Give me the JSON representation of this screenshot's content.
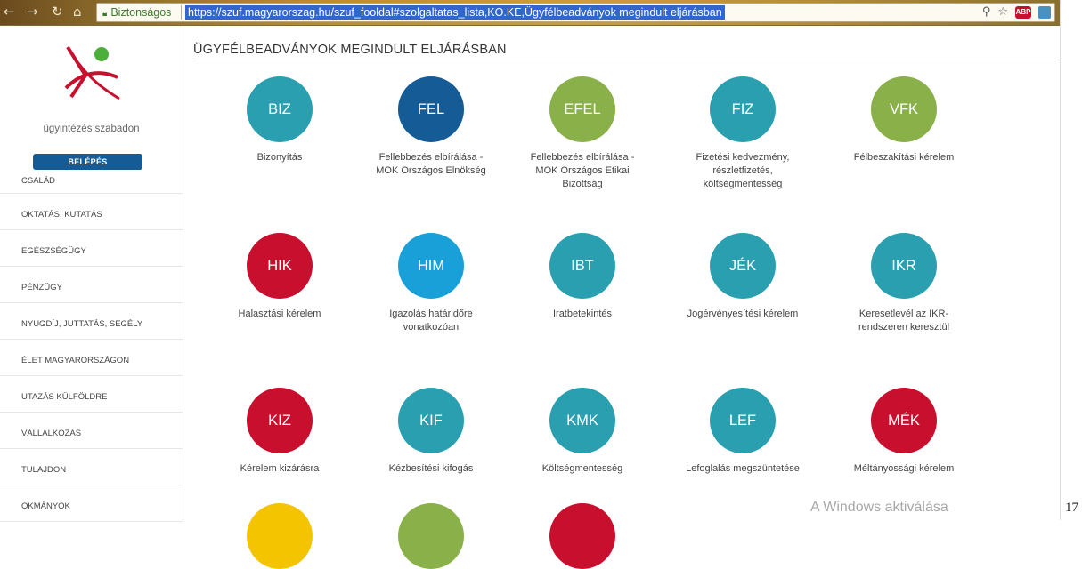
{
  "browser": {
    "secure_label": "Biztonságos",
    "url": "https://szuf.magyarorszag.hu/szuf_fooldal#szolgaltatas_lista,KO.KE,Ügyfélbeadványok megindult eljárásban",
    "abp_label": "ABP"
  },
  "sidebar": {
    "logo_text": "ügyintézés szabadon",
    "login_label": "BELÉPÉS",
    "items": [
      {
        "label": "CSALÁD"
      },
      {
        "label": "OKTATÁS, KUTATÁS"
      },
      {
        "label": "EGÉSZSÉGÜGY"
      },
      {
        "label": "PÉNZÜGY"
      },
      {
        "label": "NYUGDÍJ, JUTTATÁS, SEGÉLY"
      },
      {
        "label": "ÉLET MAGYARORSZÁGON"
      },
      {
        "label": "UTAZÁS KÜLFÖLDRE"
      },
      {
        "label": "VÁLLALKOZÁS"
      },
      {
        "label": "TULAJDON"
      },
      {
        "label": "OKMÁNYOK"
      }
    ]
  },
  "main": {
    "title": "ÜGYFÉLBEADVÁNYOK MEGINDULT ELJÁRÁSBAN",
    "tiles": [
      {
        "code": "BIZ",
        "label": "Bizonyítás",
        "color": "#2a9fb0"
      },
      {
        "code": "FEL",
        "label": "Fellebbezés elbírálása - MOK Országos Elnökség",
        "color": "#155b95"
      },
      {
        "code": "EFEL",
        "label": "Fellebbezés elbírálása - MOK Országos Etikai Bizottság",
        "color": "#8ab04a"
      },
      {
        "code": "FIZ",
        "label": "Fizetési kedvezmény, részletfizetés, költségmentesség",
        "color": "#2a9fb0"
      },
      {
        "code": "VFK",
        "label": "Félbeszakítási kérelem",
        "color": "#8ab04a"
      },
      {
        "code": "HIK",
        "label": "Halasztási kérelem",
        "color": "#c8102e"
      },
      {
        "code": "HIM",
        "label": "Igazolás határidőre vonatkozóan",
        "color": "#1aa0d8"
      },
      {
        "code": "IBT",
        "label": "Iratbetekintés",
        "color": "#2a9fb0"
      },
      {
        "code": "JÉK",
        "label": "Jogérvényesítési kérelem",
        "color": "#2a9fb0"
      },
      {
        "code": "IKR",
        "label": "Keresetlevél az IKR-rendszeren keresztül",
        "color": "#2a9fb0"
      },
      {
        "code": "KIZ",
        "label": "Kérelem kizárásra",
        "color": "#c8102e"
      },
      {
        "code": "KIF",
        "label": "Kézbesítési kifogás",
        "color": "#2a9fb0"
      },
      {
        "code": "KMK",
        "label": "Költségmentesség",
        "color": "#2a9fb0"
      },
      {
        "code": "LEF",
        "label": "Lefoglalás megszüntetése",
        "color": "#2a9fb0"
      },
      {
        "code": "MÉK",
        "label": "Méltányossági kérelem",
        "color": "#c8102e"
      },
      {
        "code": "",
        "label": "",
        "color": "#f5c400"
      },
      {
        "code": "",
        "label": "",
        "color": "#8ab04a"
      },
      {
        "code": "",
        "label": "",
        "color": "#c8102e"
      }
    ]
  },
  "watermark": "A Windows aktiválása",
  "side_number": "17"
}
